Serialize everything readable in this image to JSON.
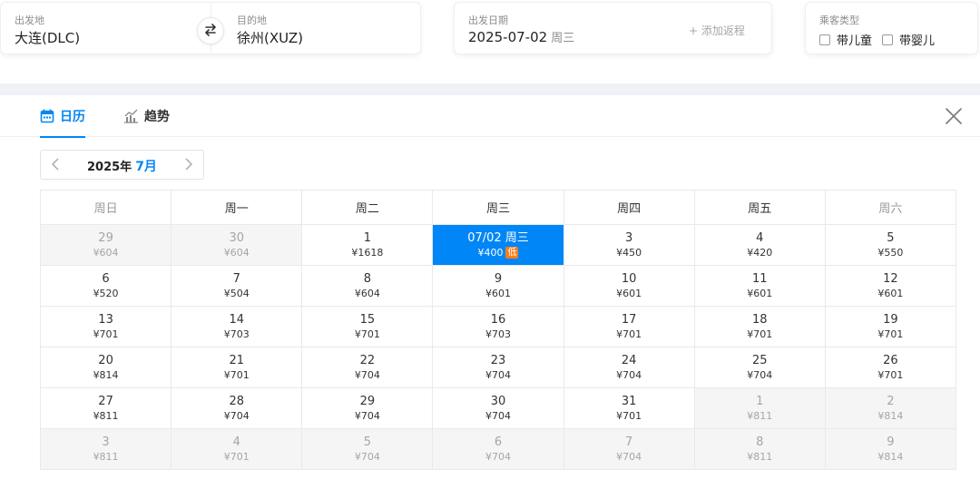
{
  "search": {
    "origin_label": "出发地",
    "origin_value": "大连(DLC)",
    "destination_label": "目的地",
    "destination_value": "徐州(XUZ)",
    "date_label": "出发日期",
    "date_value": "2025-07-02",
    "date_weekday": "周三",
    "add_return": "+ 添加返程",
    "passenger_label": "乘客类型",
    "child_option": "带儿童",
    "infant_option": "带婴儿"
  },
  "tabs": {
    "calendar": "日历",
    "trend": "趋势"
  },
  "month_nav": {
    "year": "2025年",
    "month": "7月"
  },
  "weekdays": [
    "周日",
    "周一",
    "周二",
    "周三",
    "周四",
    "周五",
    "周六"
  ],
  "low_badge": "低",
  "colors": {
    "accent": "#0086f6",
    "low_badge": "#ff7d1a"
  },
  "calendar": [
    [
      {
        "day": "29",
        "price": "¥604",
        "other_month": true
      },
      {
        "day": "30",
        "price": "¥604",
        "other_month": true
      },
      {
        "day": "1",
        "price": "¥1618"
      },
      {
        "day": "07/02 周三",
        "price": "¥400",
        "selected": true,
        "low": true
      },
      {
        "day": "3",
        "price": "¥450"
      },
      {
        "day": "4",
        "price": "¥420"
      },
      {
        "day": "5",
        "price": "¥550"
      }
    ],
    [
      {
        "day": "6",
        "price": "¥520"
      },
      {
        "day": "7",
        "price": "¥504"
      },
      {
        "day": "8",
        "price": "¥604"
      },
      {
        "day": "9",
        "price": "¥601"
      },
      {
        "day": "10",
        "price": "¥601"
      },
      {
        "day": "11",
        "price": "¥601"
      },
      {
        "day": "12",
        "price": "¥601"
      }
    ],
    [
      {
        "day": "13",
        "price": "¥701"
      },
      {
        "day": "14",
        "price": "¥703"
      },
      {
        "day": "15",
        "price": "¥701"
      },
      {
        "day": "16",
        "price": "¥703"
      },
      {
        "day": "17",
        "price": "¥701"
      },
      {
        "day": "18",
        "price": "¥701"
      },
      {
        "day": "19",
        "price": "¥701"
      }
    ],
    [
      {
        "day": "20",
        "price": "¥814"
      },
      {
        "day": "21",
        "price": "¥701"
      },
      {
        "day": "22",
        "price": "¥704"
      },
      {
        "day": "23",
        "price": "¥704"
      },
      {
        "day": "24",
        "price": "¥704"
      },
      {
        "day": "25",
        "price": "¥704"
      },
      {
        "day": "26",
        "price": "¥701"
      }
    ],
    [
      {
        "day": "27",
        "price": "¥811"
      },
      {
        "day": "28",
        "price": "¥704"
      },
      {
        "day": "29",
        "price": "¥704"
      },
      {
        "day": "30",
        "price": "¥704"
      },
      {
        "day": "31",
        "price": "¥701"
      },
      {
        "day": "1",
        "price": "¥811",
        "other_month": true
      },
      {
        "day": "2",
        "price": "¥814",
        "other_month": true
      }
    ],
    [
      {
        "day": "3",
        "price": "¥811",
        "other_month": true
      },
      {
        "day": "4",
        "price": "¥701",
        "other_month": true
      },
      {
        "day": "5",
        "price": "¥704",
        "other_month": true
      },
      {
        "day": "6",
        "price": "¥704",
        "other_month": true
      },
      {
        "day": "7",
        "price": "¥704",
        "other_month": true
      },
      {
        "day": "8",
        "price": "¥811",
        "other_month": true
      },
      {
        "day": "9",
        "price": "¥814",
        "other_month": true
      }
    ]
  ]
}
